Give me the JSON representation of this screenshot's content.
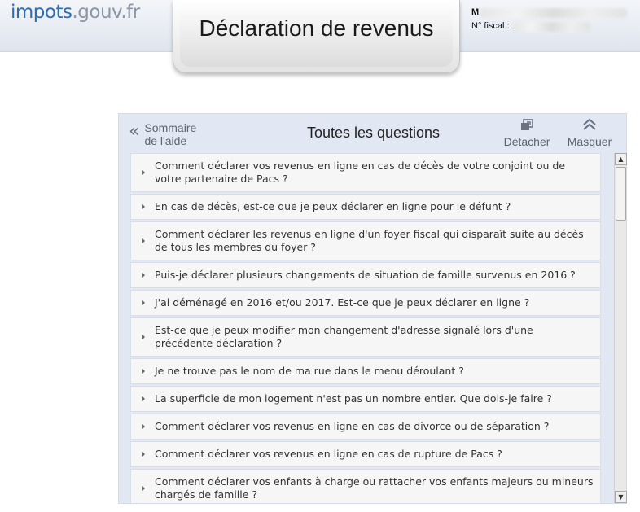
{
  "header": {
    "logo_part1": "impots",
    "logo_part2": ".gouv.fr",
    "title": "Déclaration de revenus",
    "user_name_prefix": "M",
    "fiscal_label": "N° fiscal :"
  },
  "panel": {
    "back_label": "Sommaire de l'aide",
    "title": "Toutes les questions",
    "detach_label": "Détacher",
    "hide_label": "Masquer",
    "icons": {
      "back": "double-chevron-left-icon",
      "detach": "detach-window-icon",
      "hide": "double-chevron-up-icon"
    }
  },
  "questions": [
    "Comment déclarer vos revenus en ligne en cas de décès de votre conjoint ou de votre partenaire de Pacs ?",
    "En cas de décès, est-ce que je peux déclarer en ligne pour le défunt ?",
    "Comment déclarer les revenus en ligne d'un foyer fiscal qui disparaît suite au décès de tous les membres du foyer ?",
    "Puis-je déclarer plusieurs changements de situation de famille survenus en 2016 ?",
    "J'ai déménagé en 2016 et/ou 2017. Est-ce que je peux déclarer en ligne ?",
    "Est-ce que je peux modifier mon changement d'adresse signalé lors d'une précédente déclaration ?",
    "Je ne trouve pas le nom de ma rue dans le menu déroulant ?",
    "La superficie de mon logement n'est pas un nombre entier. Que dois-je faire ?",
    "Comment déclarer vos revenus en ligne en cas de divorce ou de séparation ?",
    "Comment déclarer vos revenus en ligne en cas de rupture de Pacs ?",
    "Comment déclarer vos enfants à charge ou rattacher vos enfants majeurs ou mineurs chargés de famille ?"
  ],
  "colors": {
    "logo_blue": "#2b6fb0",
    "logo_grey": "#8a97a6",
    "panel_bg": "#e1e7f3"
  }
}
